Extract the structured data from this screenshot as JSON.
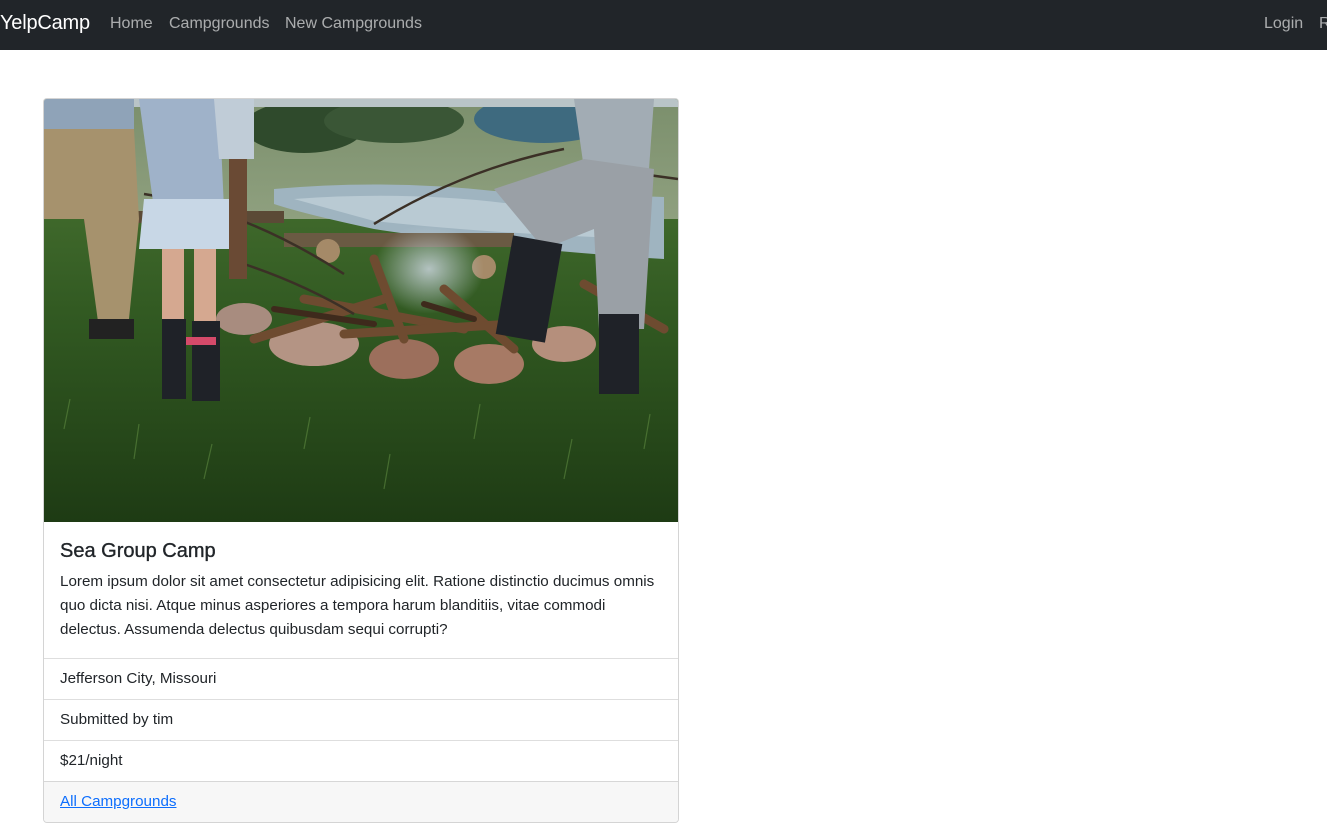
{
  "navbar": {
    "brand": "YelpCamp",
    "links": {
      "home": "Home",
      "campgrounds": "Campgrounds",
      "new_campground": "New Campgrounds",
      "login": "Login",
      "register": "R"
    }
  },
  "campground": {
    "image_icon": "campfire-photo",
    "title": "Sea Group Camp",
    "description": "Lorem ipsum dolor sit amet consectetur adipisicing elit. Ratione distinctio ducimus omnis quo dicta nisi. Atque minus asperiores a tempora harum blanditiis, vitae commodi delectus. Assumenda delectus quibusdam sequi corrupti?",
    "location": "Jefferson City, Missouri",
    "submitted_by": "Submitted by tim",
    "price": "$21/night",
    "footer_link": "All Campgrounds"
  },
  "colors": {
    "navbar_bg": "#212529",
    "link": "#0d6efd",
    "footer_bg": "#f7f7f7"
  }
}
